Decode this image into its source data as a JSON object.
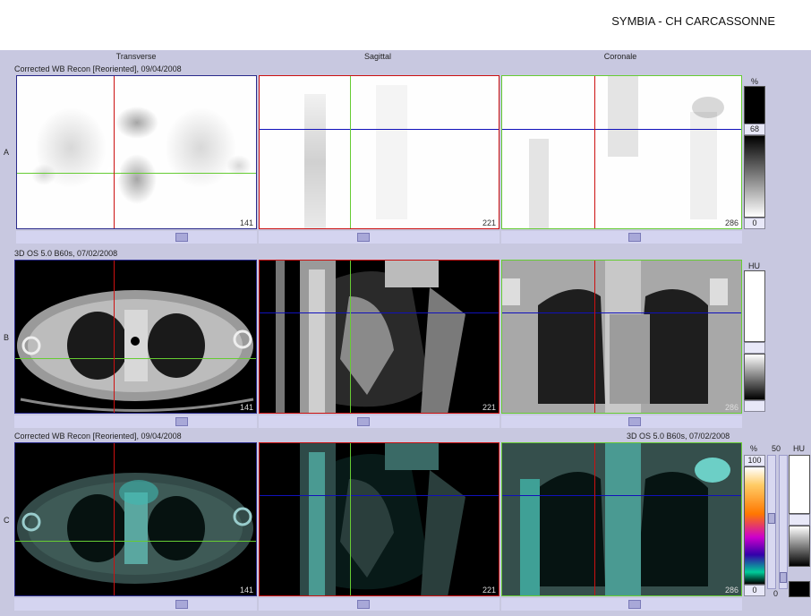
{
  "header": {
    "title": "SYMBIA - CH CARCASSONNE"
  },
  "columns": [
    "Transverse",
    "Sagittal",
    "Coronale"
  ],
  "rows": [
    {
      "label": "A",
      "series": "Corrected WB Recon [Reoriented], 09/04/2008",
      "series_right": "",
      "slices": [
        "141",
        "221",
        "286"
      ]
    },
    {
      "label": "B",
      "series": "3D OS 5.0 B60s, 07/02/2008",
      "series_right": "",
      "slices": [
        "141",
        "221",
        "286"
      ]
    },
    {
      "label": "C",
      "series": "Corrected WB Recon [Reoriented], 09/04/2008",
      "series_right": "3D OS 5.0 B60s, 07/02/2008",
      "slices": [
        "141",
        "221",
        "286"
      ]
    }
  ],
  "colorbars": {
    "a": {
      "unit": "%",
      "value": "68",
      "min": "0"
    },
    "b": {
      "unit": "HU"
    },
    "c_pet": {
      "unit": "%",
      "max": "100",
      "min": "0"
    },
    "c_ct": {
      "unit": "HU",
      "value": "50",
      "min": "0"
    }
  },
  "colors": {
    "red": "#cc1111",
    "green": "#66cc33",
    "blue": "#1111bb",
    "frame_bg": "#c8c8e0"
  }
}
